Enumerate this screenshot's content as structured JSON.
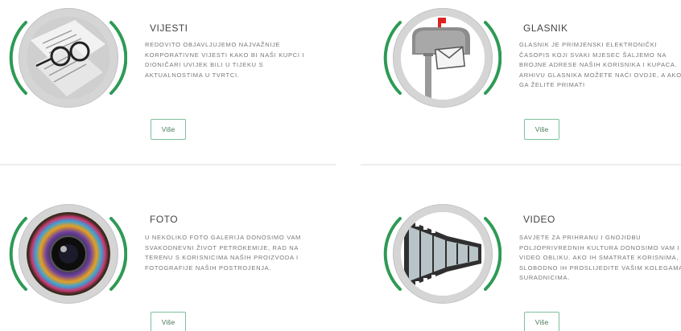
{
  "theme": {
    "accent": "#2e9a55",
    "ring": "#d5d5d5",
    "button_border": "#7fbf9a"
  },
  "cards": [
    {
      "title": "VIJESTI",
      "icon": "newspaper-glasses-icon",
      "text": "REDOVITO OBJAVLJUJEMO NAJVAŽNIJE KORPORATIVNE VIJESTI KAKO BI NAŠI KUPCI I DIONIČARI UVIJEK BILI U TIJEKU S AKTUALNOSTIMA U TVRTCI.",
      "button": "Više"
    },
    {
      "title": "GLASNIK",
      "icon": "mailbox-icon",
      "text": "GLASNIK JE PRIMJENSKI ELEKTRONIČKI ČASOPIS KOJI SVAKI MJESEC ŠALJEMO NA BROJNE ADRESE NAŠIH KORISNIKA I KUPACA. ARHIVU GLASNIKA MOŽETE NAĆI OVDJE, A AKO GA ŽELITE PRIMATI",
      "button": "Više"
    },
    {
      "title": "FOTO",
      "icon": "camera-lens-icon",
      "text": "U NEKOLIKO FOTO GALERIJA DONOSIMO VAM SVAKODNEVNI ŽIVOT PETROKEMIJE, RAD NA TERENU S KORISNICIMA NAŠIH PROIZVODA I FOTOGRAFIJE NAŠIH POSTROJENJA.",
      "button": "Više"
    },
    {
      "title": "VIDEO",
      "icon": "film-strip-icon",
      "text": "SAVJETE ZA PRIHRANU I GNOJIDBU POLJOPRIVREDNIH KULTURA DONOSIMO VAM I U VIDEO OBLIKU. AKO IH SMATRATE KORISNIMA, SLOBODNO IH PROSLIJEDITE VAŠIM KOLEGAMA I SURADNICIMA.",
      "button": "Više"
    }
  ]
}
